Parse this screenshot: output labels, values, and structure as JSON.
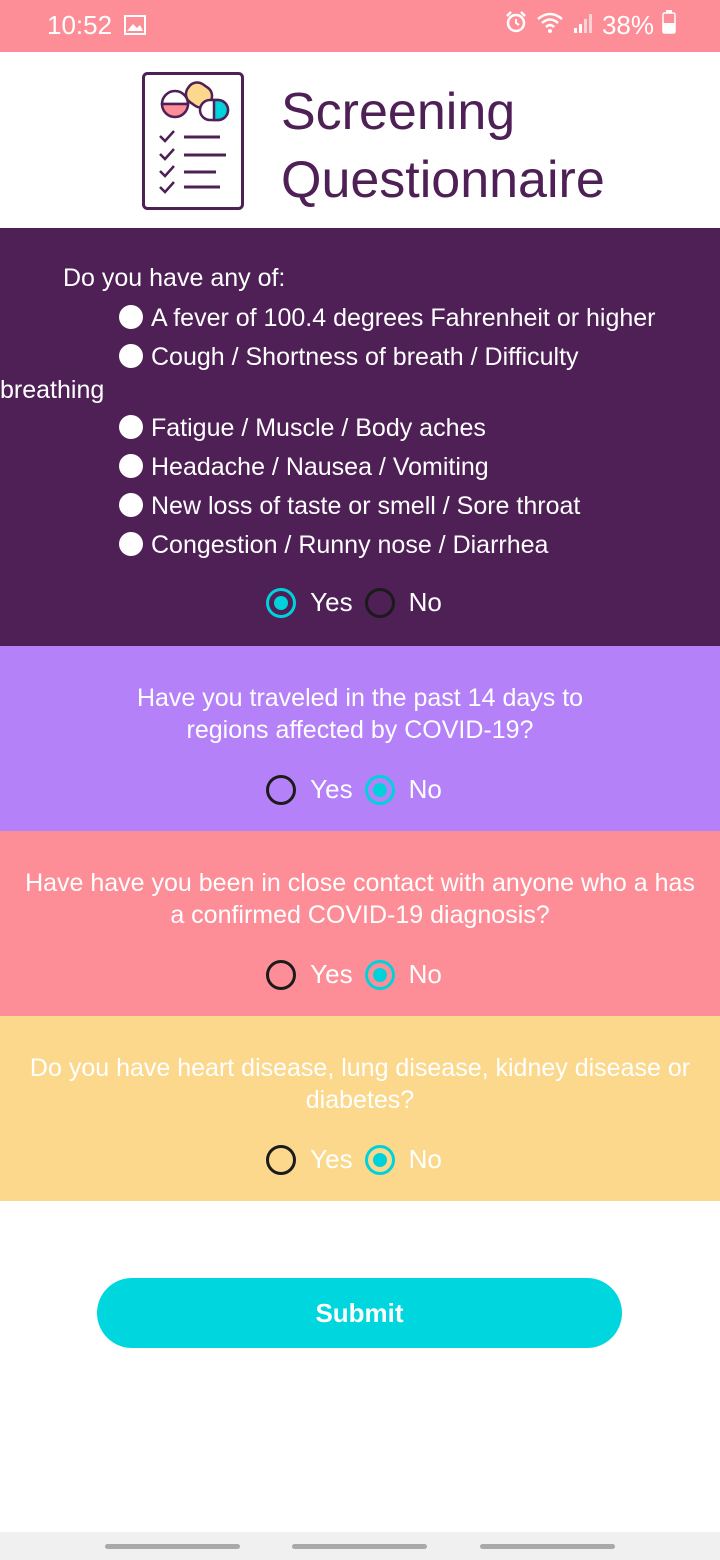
{
  "status": {
    "time": "10:52",
    "battery": "38%",
    "icons": [
      "image-icon",
      "alarm-icon",
      "wifi-icon",
      "signal-icon",
      "battery-icon"
    ]
  },
  "header": {
    "title_line1": "Screening",
    "title_line2": "Questionnaire",
    "logo": "checklist-pills-icon"
  },
  "q1": {
    "prompt": "Do you have any of:",
    "symptoms": [
      "A fever of 100.4 degrees Fahrenheit or higher",
      "Cough / Shortness of breath / Difficulty",
      "breathing",
      "Fatigue / Muscle / Body aches",
      "Headache / Nausea / Vomiting",
      "New loss of taste or smell / Sore throat",
      "Congestion / Runny nose / Diarrhea"
    ],
    "yes_label": "Yes",
    "no_label": "No",
    "selected": "Yes"
  },
  "q2": {
    "question_line1": "Have you traveled in the past 14 days to",
    "question_line2": "regions affected by COVID-19?",
    "yes_label": "Yes",
    "no_label": "No",
    "selected": "No"
  },
  "q3": {
    "question_line1": "Have have you been in close contact with anyone who a has",
    "question_line2": "a confirmed COVID-19 diagnosis?",
    "yes_label": "Yes",
    "no_label": "No",
    "selected": "No"
  },
  "q4": {
    "question_line1": "Do you have heart disease, lung disease, kidney disease or",
    "question_line2": "diabetes?",
    "yes_label": "Yes",
    "no_label": "No",
    "selected": "No"
  },
  "submit_label": "Submit",
  "colors": {
    "status_bar": "#fd8e97",
    "q1_bg": "#4e2056",
    "q2_bg": "#b481f9",
    "q3_bg": "#fd8e97",
    "q4_bg": "#fcd88d",
    "accent": "#00d2dc",
    "title": "#4e2056"
  }
}
